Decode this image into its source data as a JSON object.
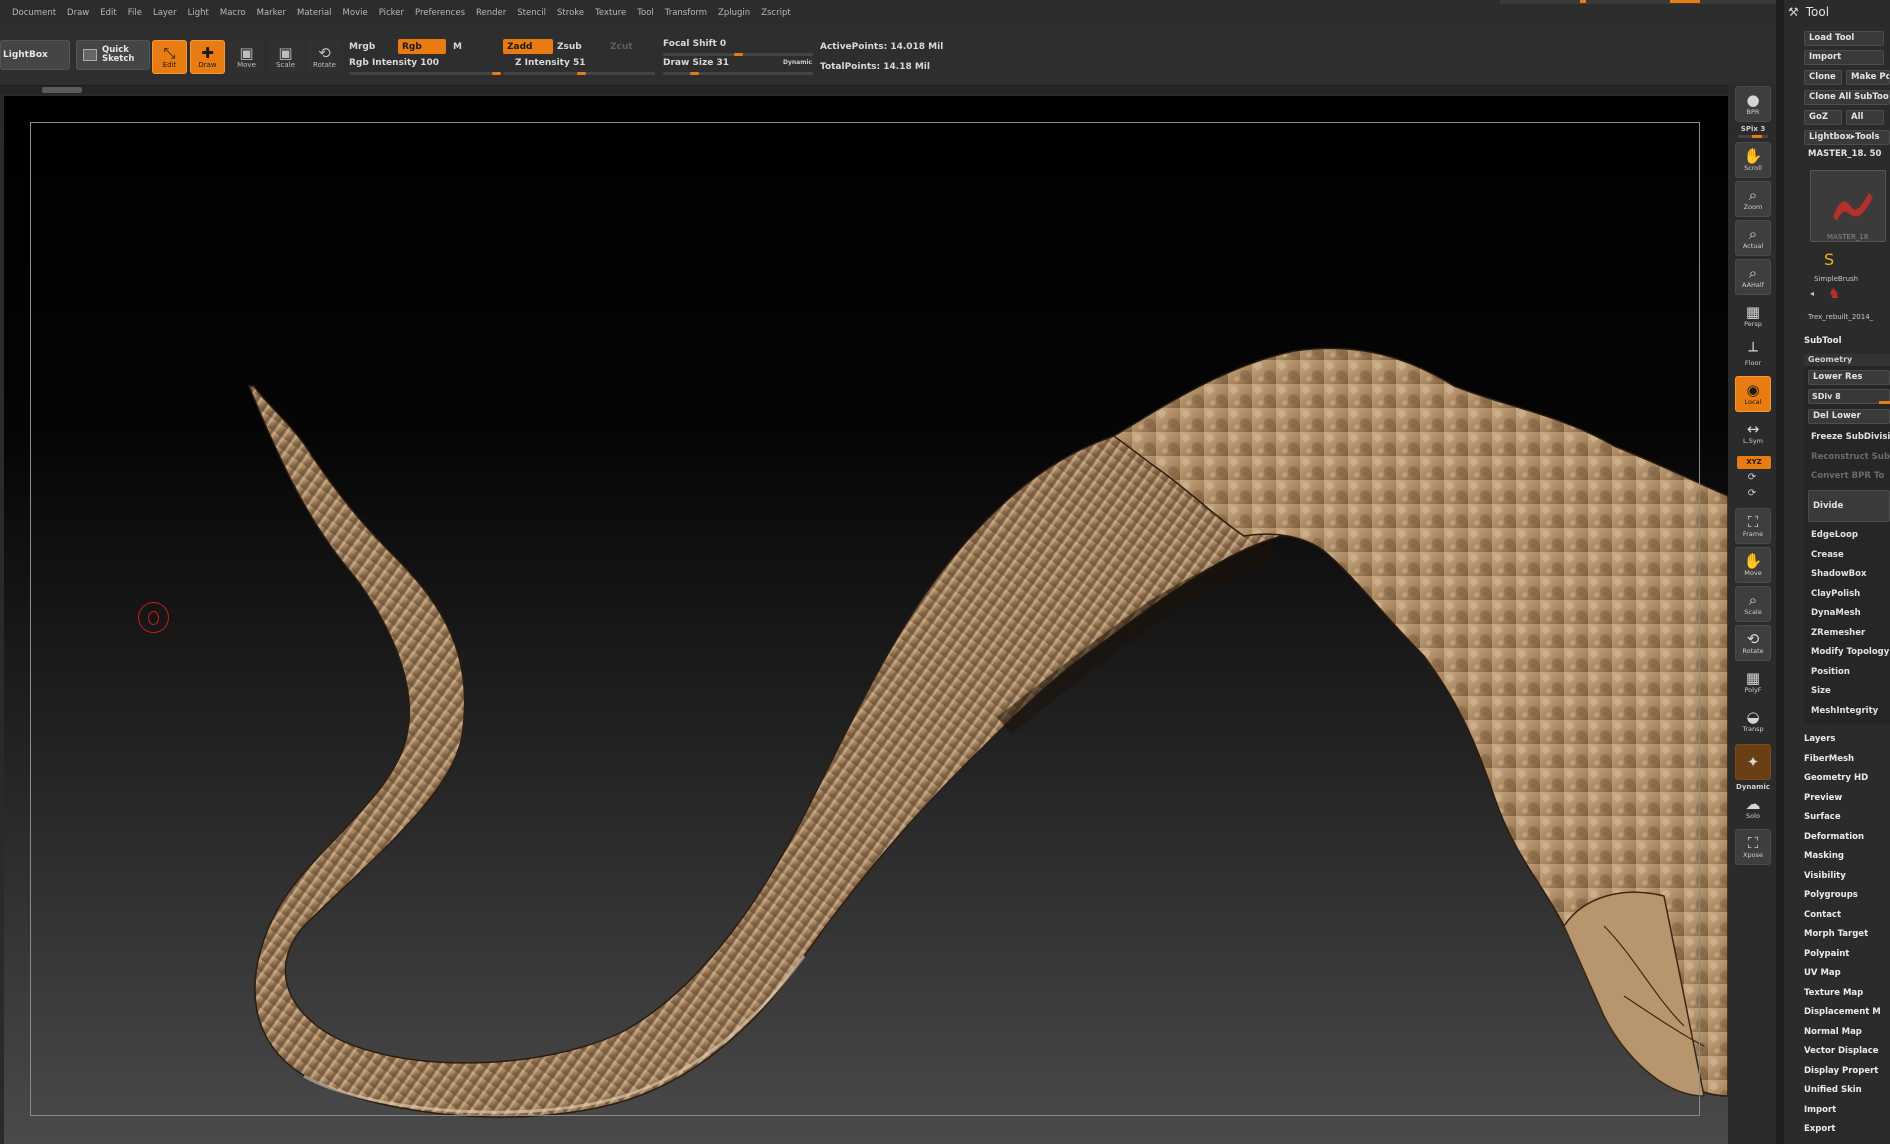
{
  "menu": [
    "Document",
    "Draw",
    "Edit",
    "File",
    "Layer",
    "Light",
    "Macro",
    "Marker",
    "Material",
    "Movie",
    "Picker",
    "Preferences",
    "Render",
    "Stencil",
    "Stroke",
    "Texture",
    "Tool",
    "Transform",
    "Zplugin",
    "Zscript"
  ],
  "toolbar": {
    "lightbox": "LightBox",
    "quick_sketch_line1": "Quick",
    "quick_sketch_line2": "Sketch",
    "edit": "Edit",
    "draw": "Draw",
    "move": "Move",
    "scale": "Scale",
    "rotate": "Rotate",
    "mrgb": "Mrgb",
    "rgb": "Rgb",
    "m": "M",
    "rgb_intensity": "Rgb Intensity 100",
    "zadd": "Zadd",
    "zsub": "Zsub",
    "zcut": "Zcut",
    "z_intensity": "Z Intensity 51",
    "focal_shift": "Focal Shift 0",
    "draw_size": "Draw Size 31",
    "dynamic": "Dynamic",
    "active_points": "ActivePoints: 14.018 Mil",
    "total_points": "TotalPoints: 14.18 Mil",
    "rgb_intensity_value": 100,
    "z_intensity_value": 51,
    "focal_shift_value": 0,
    "draw_size_value": 31
  },
  "shelf": {
    "bpr": "BPR",
    "spix": "SPix 3",
    "scroll": "Scroll",
    "zoom": "Zoom",
    "actual": "Actual",
    "aahalf": "AAHalf",
    "persp": "Persp",
    "floor": "Floor",
    "local": "Local",
    "lsym": "L.Sym",
    "xyz": "XYZ",
    "frame": "Frame",
    "move": "Move",
    "scale": "Scale",
    "rotate": "Rotate",
    "polyf": "PolyF",
    "transp": "Transp",
    "dynamic": "Dynamic",
    "solo": "Solo",
    "xpose": "Xpose"
  },
  "tool_palette": {
    "title": "Tool",
    "load_tool": "Load Tool",
    "import": "Import",
    "clone": "Clone",
    "make_polymesh": "Make Po",
    "clone_all": "Clone All SubToo",
    "goz": "GoZ",
    "all": "All",
    "lightbox_tools": "Lightbox▸Tools",
    "current_tool": "MASTER_18. 50",
    "thumb_label": "MASTER_18",
    "simplebrush": "SimpleBrush",
    "trex": "Trex_rebuilt_2014_",
    "subtool": "SubTool",
    "geometry": "Geometry",
    "lower_res": "Lower Res",
    "sdiv": "SDiv 8",
    "del_lower": "Del Lower",
    "freeze": "Freeze SubDivisi",
    "reconstruct": "Reconstruct Sub",
    "convert_bpr": "Convert BPR To",
    "divide": "Divide",
    "geo_items": [
      "EdgeLoop",
      "Crease",
      "ShadowBox",
      "ClayPolish",
      "DynaMesh",
      "ZRemesher",
      "Modify Topology",
      "Position",
      "Size",
      "MeshIntegrity"
    ],
    "sections": [
      "Layers",
      "FiberMesh",
      "Geometry HD",
      "Preview",
      "Surface",
      "Deformation",
      "Masking",
      "Visibility",
      "Polygroups",
      "Contact",
      "Morph Target",
      "Polypaint",
      "UV Map",
      "Texture Map",
      "Displacement M",
      "Normal Map",
      "Vector Displace",
      "Display Propert",
      "Unified Skin",
      "Import",
      "Export"
    ]
  },
  "colors": {
    "accent": "#e87c12",
    "clay": "#a88661",
    "clay_highlight": "#dcc3a0",
    "clay_shadow": "#3d2a18",
    "cursor": "#c91b1b"
  }
}
